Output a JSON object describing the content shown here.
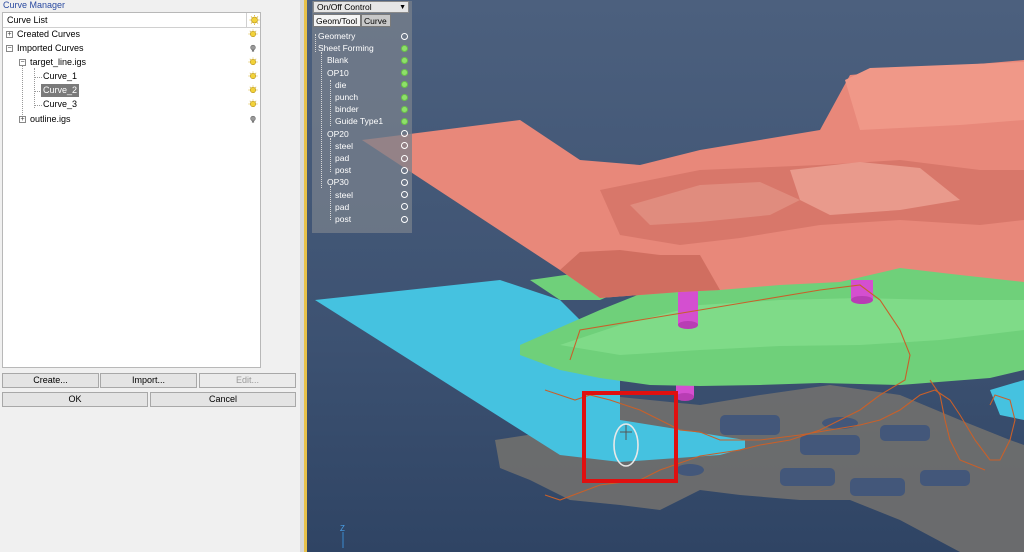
{
  "window": {
    "title": "Curve Manager"
  },
  "curve_list": {
    "header": "Curve List",
    "items": [
      {
        "label": "Created Curves",
        "depth": 0,
        "expander": "+",
        "bulb": "on"
      },
      {
        "label": "Imported Curves",
        "depth": 0,
        "expander": "-",
        "bulb": "off"
      },
      {
        "label": "target_line.igs",
        "depth": 1,
        "expander": "-",
        "bulb": "on"
      },
      {
        "label": "Curve_1",
        "depth": 2,
        "bulb": "on"
      },
      {
        "label": "Curve_2",
        "depth": 2,
        "bulb": "on",
        "selected": true
      },
      {
        "label": "Curve_3",
        "depth": 2,
        "bulb": "on"
      },
      {
        "label": "outline.igs",
        "depth": 1,
        "expander": "+",
        "bulb": "off"
      }
    ]
  },
  "buttons": {
    "create": "Create...",
    "import": "Import...",
    "edit": "Edit...",
    "ok": "OK",
    "cancel": "Cancel"
  },
  "control": {
    "dropdown": "On/Off Control",
    "tabs": [
      "Geom/Tool",
      "Curve"
    ],
    "items": [
      {
        "label": "Geometry",
        "depth": 0,
        "state": "off"
      },
      {
        "label": "Sheet Forming",
        "depth": 0,
        "state": "on"
      },
      {
        "label": "Blank",
        "depth": 1,
        "state": "on"
      },
      {
        "label": "OP10",
        "depth": 1,
        "state": "on"
      },
      {
        "label": "die",
        "depth": 2,
        "state": "on"
      },
      {
        "label": "punch",
        "depth": 2,
        "state": "on"
      },
      {
        "label": "binder",
        "depth": 2,
        "state": "on"
      },
      {
        "label": "Guide Type1",
        "depth": 2,
        "state": "on"
      },
      {
        "label": "OP20",
        "depth": 1,
        "state": "off"
      },
      {
        "label": "steel",
        "depth": 2,
        "state": "off"
      },
      {
        "label": "pad",
        "depth": 2,
        "state": "off"
      },
      {
        "label": "post",
        "depth": 2,
        "state": "off"
      },
      {
        "label": "OP30",
        "depth": 1,
        "state": "off"
      },
      {
        "label": "steel",
        "depth": 2,
        "state": "off"
      },
      {
        "label": "pad",
        "depth": 2,
        "state": "off"
      },
      {
        "label": "post",
        "depth": 2,
        "state": "off"
      }
    ]
  },
  "viewport": {
    "axis_label": "Z"
  },
  "colors": {
    "die": "#e8887a",
    "binder": "#6fd07a",
    "blank": "#45c2e0",
    "punch_posts": "#d44fd0",
    "outline": "#6e6e6e",
    "curve": "#c8602a",
    "highlight_box": "#e01010"
  }
}
